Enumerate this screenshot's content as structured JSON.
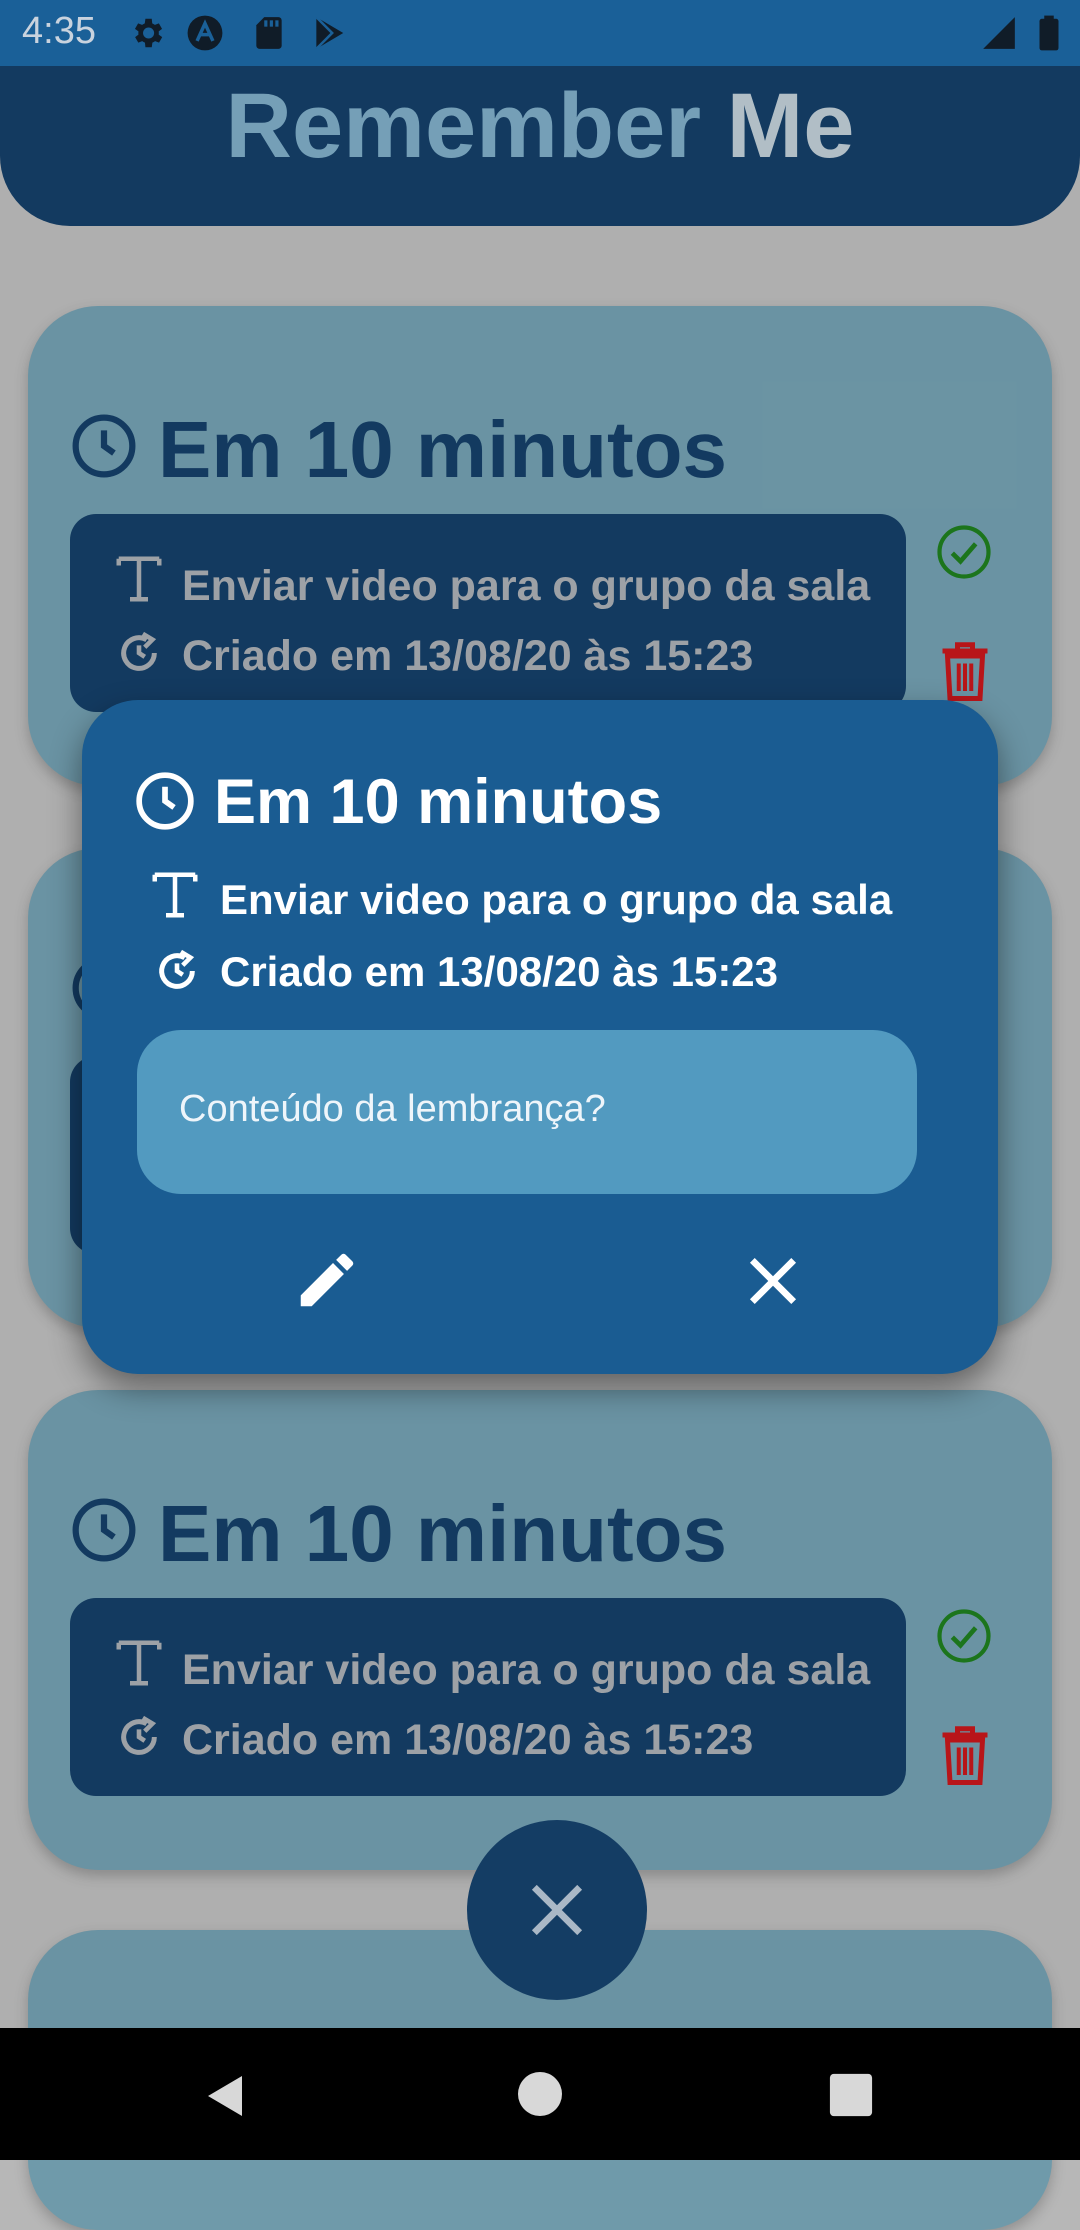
{
  "status_bar": {
    "time": "4:35",
    "left_icons": [
      "gear-icon",
      "a-circle-icon",
      "sd-card-icon",
      "play-store-icon"
    ],
    "right_icons": [
      "signal-icon",
      "battery-icon"
    ]
  },
  "app": {
    "title_part1": "Remember",
    "title_part2": "Me"
  },
  "reminders": [
    {
      "when": "Em 10 minutos",
      "text": "Enviar video para o grupo da sala",
      "created": "Criado em 13/08/20 às 15:23"
    },
    {
      "when": "Em 10 minutos",
      "text": "Enviar video para o grupo da sala",
      "created": "Criado em 13/08/20 às 15:23"
    }
  ],
  "dialog": {
    "when": "Em 10 minutos",
    "text": "Enviar video para o grupo da sala",
    "created": "Criado em 13/08/20 às 15:23",
    "input_placeholder": "Conteúdo da lembrança?",
    "actions": [
      "edit-icon",
      "close-icon"
    ]
  },
  "fab": {
    "icon": "close-icon"
  },
  "nav_bar": {
    "icons": [
      "back-icon",
      "home-icon",
      "recents-icon"
    ]
  },
  "colors": {
    "primary_dark": "#143d64",
    "primary": "#1a5c92",
    "card": "#6f9aaa",
    "input": "#529ac0",
    "check": "#1e7a1e",
    "delete": "#c0161b"
  }
}
